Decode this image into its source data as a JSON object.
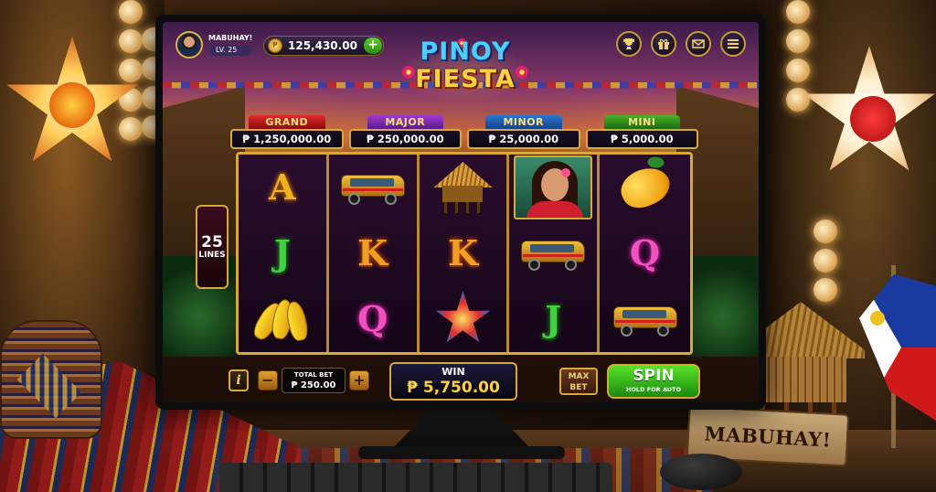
{
  "player": {
    "name": "MABUHAY!",
    "level": "LV. 25"
  },
  "balance": {
    "coins": "125,430.00",
    "add_label": "+"
  },
  "title": {
    "line1": "PINOY",
    "line2": "FIESTA"
  },
  "hud_icons": [
    "trophy-icon",
    "gift-icon",
    "mail-icon",
    "menu-icon"
  ],
  "jackpots": [
    {
      "label": "GRAND",
      "value": "₱ 1,250,000.00",
      "color": "#e02a2a"
    },
    {
      "label": "MAJOR",
      "value": "₱ 250,000.00",
      "color": "#a03ad0"
    },
    {
      "label": "MINOR",
      "value": "₱ 25,000.00",
      "color": "#2a7ad0"
    },
    {
      "label": "MINI",
      "value": "₱ 5,000.00",
      "color": "#4ab02a"
    }
  ],
  "lines": {
    "count": "25",
    "label": "LINES"
  },
  "reels": [
    [
      "A",
      "jeepney",
      "bahay-kubo",
      "dalaga",
      "mango"
    ],
    [
      "J",
      "K",
      "K",
      "jeepney",
      "Q"
    ],
    [
      "banana",
      "Q",
      "parol",
      "J",
      "jeepney"
    ]
  ],
  "controls": {
    "info_label": "i",
    "minus_label": "−",
    "plus_label": "+",
    "total_bet_label": "TOTAL BET",
    "total_bet_value": "₱ 250.00",
    "win_label": "WIN",
    "win_value": "₱ 5,750.00",
    "max_bet_line1": "MAX",
    "max_bet_line2": "BET",
    "spin_label": "SPIN",
    "spin_sub": "HOLD FOR AUTO"
  },
  "scene": {
    "sign_text": "MABUHAY!"
  }
}
